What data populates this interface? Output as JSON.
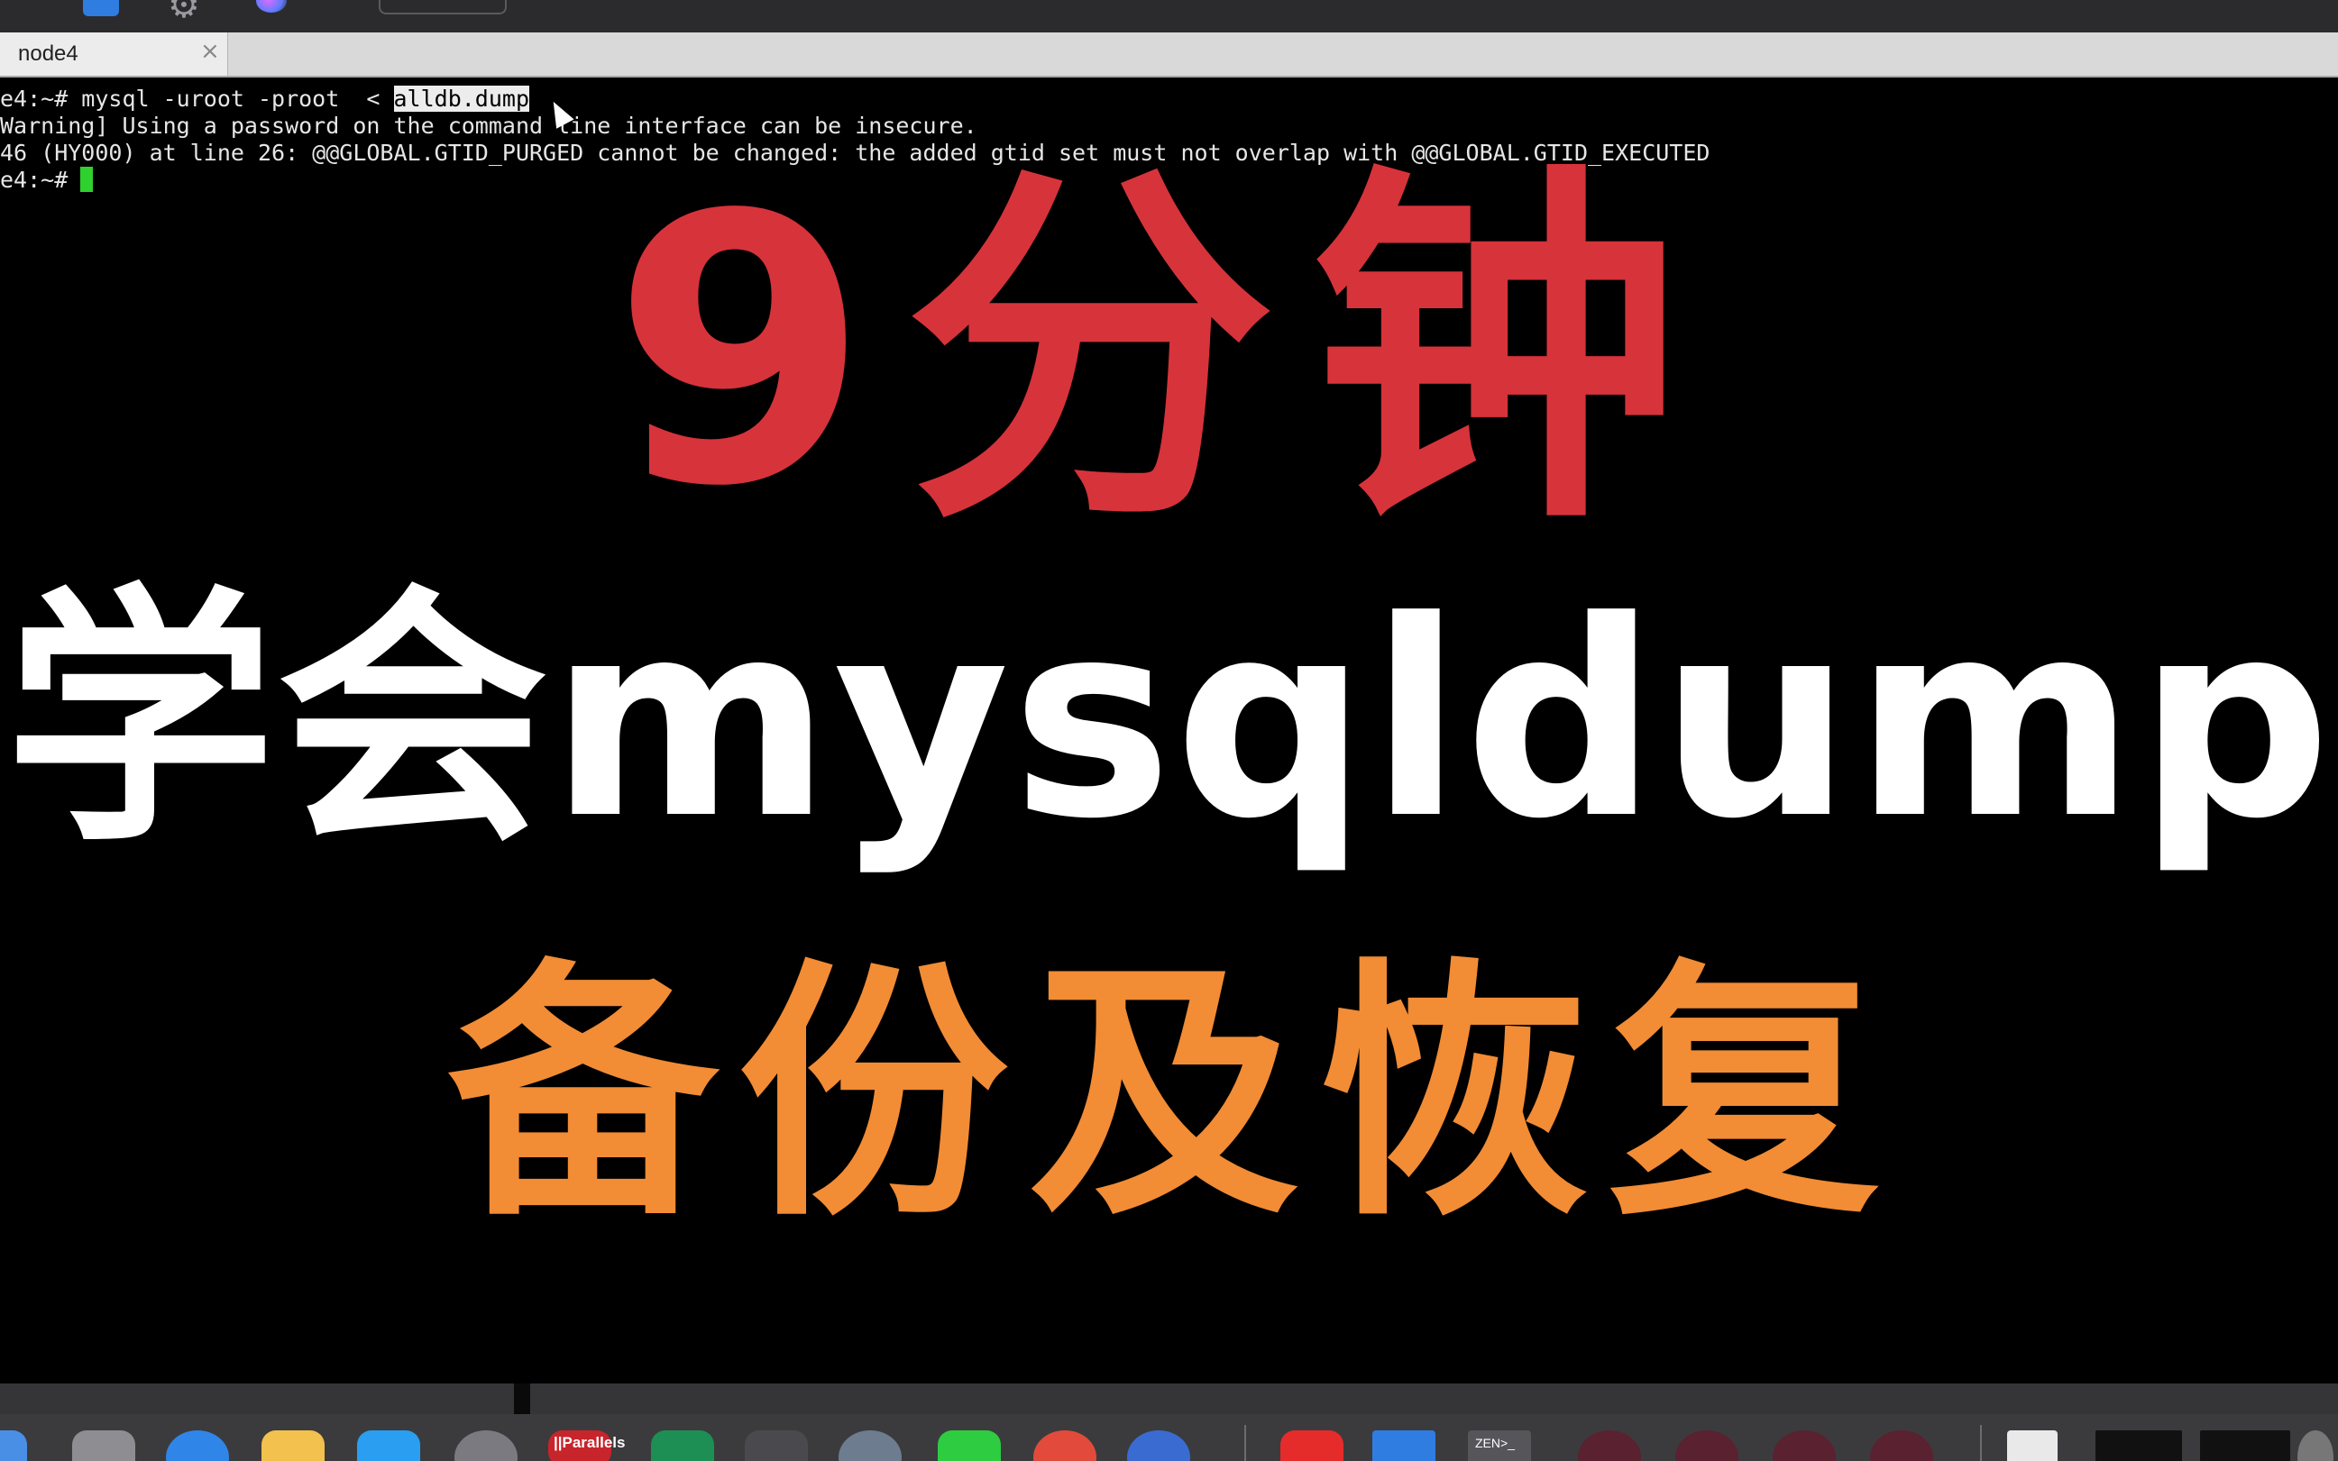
{
  "tab": {
    "label": "node4",
    "close_glyph": "×"
  },
  "terminal": {
    "line1_prefix": "e4:~# mysql -uroot -proot  < ",
    "line1_selected": "alldb.dump",
    "line2": "Warning] Using a password on the command line interface can be insecure.",
    "line3": "46 (HY000) at line 26: @@GLOBAL.GTID_PURGED cannot be changed: the added gtid set must not overlap with @@GLOBAL.GTID_EXECUTED",
    "line4_prompt": "e4:~#",
    "cursor_color": "#2fd12f",
    "selection_color": "#ececec"
  },
  "overlay": {
    "title_red": "9分钟",
    "title_white": "学会mysqldump",
    "title_orange": "备份及恢复",
    "colors": {
      "red": "#d7333b",
      "white": "#ffffff",
      "orange": "#f28c35"
    }
  },
  "dock": {
    "parallels_label": "||Parallels",
    "zen_label": "ZEN>_",
    "icons": [
      "finder-icon",
      "launchpad-icon",
      "safari-icon",
      "photos-icon",
      "xcode-icon",
      "system-preferences-icon",
      "parallels-icon",
      "clion-icon",
      "sublime-icon",
      "monitor-icon",
      "wechat-icon",
      "chrome-icon",
      "proxyman-icon",
      "youtube-icon",
      "windows-icon",
      "zen-terminal-icon",
      "recorder-icon",
      "file-icon",
      "window-thumbnail-icon"
    ]
  },
  "menubar": {
    "icons": [
      "app-blue-icon",
      "gear-icon",
      "siri-icon"
    ]
  }
}
